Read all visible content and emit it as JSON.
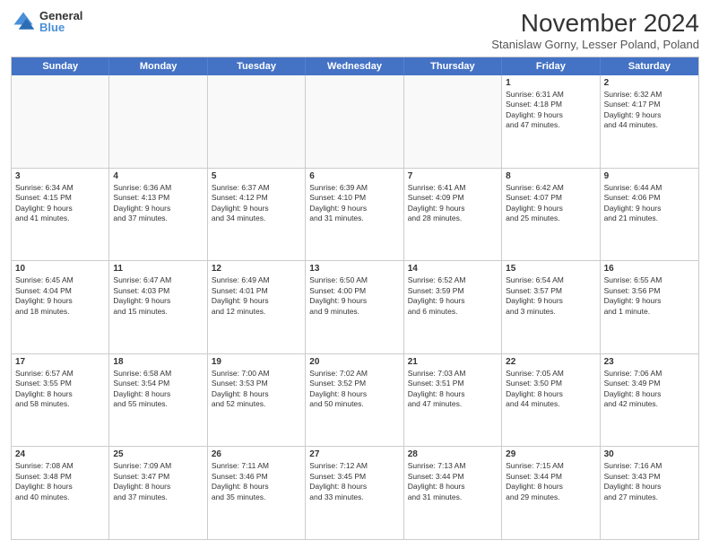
{
  "logo": {
    "general": "General",
    "blue": "Blue"
  },
  "title": "November 2024",
  "subtitle": "Stanislaw Gorny, Lesser Poland, Poland",
  "dayHeaders": [
    "Sunday",
    "Monday",
    "Tuesday",
    "Wednesday",
    "Thursday",
    "Friday",
    "Saturday"
  ],
  "weeks": [
    [
      {
        "day": "",
        "info": "",
        "empty": true
      },
      {
        "day": "",
        "info": "",
        "empty": true
      },
      {
        "day": "",
        "info": "",
        "empty": true
      },
      {
        "day": "",
        "info": "",
        "empty": true
      },
      {
        "day": "",
        "info": "",
        "empty": true
      },
      {
        "day": "1",
        "info": "Sunrise: 6:31 AM\nSunset: 4:18 PM\nDaylight: 9 hours\nand 47 minutes."
      },
      {
        "day": "2",
        "info": "Sunrise: 6:32 AM\nSunset: 4:17 PM\nDaylight: 9 hours\nand 44 minutes."
      }
    ],
    [
      {
        "day": "3",
        "info": "Sunrise: 6:34 AM\nSunset: 4:15 PM\nDaylight: 9 hours\nand 41 minutes."
      },
      {
        "day": "4",
        "info": "Sunrise: 6:36 AM\nSunset: 4:13 PM\nDaylight: 9 hours\nand 37 minutes."
      },
      {
        "day": "5",
        "info": "Sunrise: 6:37 AM\nSunset: 4:12 PM\nDaylight: 9 hours\nand 34 minutes."
      },
      {
        "day": "6",
        "info": "Sunrise: 6:39 AM\nSunset: 4:10 PM\nDaylight: 9 hours\nand 31 minutes."
      },
      {
        "day": "7",
        "info": "Sunrise: 6:41 AM\nSunset: 4:09 PM\nDaylight: 9 hours\nand 28 minutes."
      },
      {
        "day": "8",
        "info": "Sunrise: 6:42 AM\nSunset: 4:07 PM\nDaylight: 9 hours\nand 25 minutes."
      },
      {
        "day": "9",
        "info": "Sunrise: 6:44 AM\nSunset: 4:06 PM\nDaylight: 9 hours\nand 21 minutes."
      }
    ],
    [
      {
        "day": "10",
        "info": "Sunrise: 6:45 AM\nSunset: 4:04 PM\nDaylight: 9 hours\nand 18 minutes."
      },
      {
        "day": "11",
        "info": "Sunrise: 6:47 AM\nSunset: 4:03 PM\nDaylight: 9 hours\nand 15 minutes."
      },
      {
        "day": "12",
        "info": "Sunrise: 6:49 AM\nSunset: 4:01 PM\nDaylight: 9 hours\nand 12 minutes."
      },
      {
        "day": "13",
        "info": "Sunrise: 6:50 AM\nSunset: 4:00 PM\nDaylight: 9 hours\nand 9 minutes."
      },
      {
        "day": "14",
        "info": "Sunrise: 6:52 AM\nSunset: 3:59 PM\nDaylight: 9 hours\nand 6 minutes."
      },
      {
        "day": "15",
        "info": "Sunrise: 6:54 AM\nSunset: 3:57 PM\nDaylight: 9 hours\nand 3 minutes."
      },
      {
        "day": "16",
        "info": "Sunrise: 6:55 AM\nSunset: 3:56 PM\nDaylight: 9 hours\nand 1 minute."
      }
    ],
    [
      {
        "day": "17",
        "info": "Sunrise: 6:57 AM\nSunset: 3:55 PM\nDaylight: 8 hours\nand 58 minutes."
      },
      {
        "day": "18",
        "info": "Sunrise: 6:58 AM\nSunset: 3:54 PM\nDaylight: 8 hours\nand 55 minutes."
      },
      {
        "day": "19",
        "info": "Sunrise: 7:00 AM\nSunset: 3:53 PM\nDaylight: 8 hours\nand 52 minutes."
      },
      {
        "day": "20",
        "info": "Sunrise: 7:02 AM\nSunset: 3:52 PM\nDaylight: 8 hours\nand 50 minutes."
      },
      {
        "day": "21",
        "info": "Sunrise: 7:03 AM\nSunset: 3:51 PM\nDaylight: 8 hours\nand 47 minutes."
      },
      {
        "day": "22",
        "info": "Sunrise: 7:05 AM\nSunset: 3:50 PM\nDaylight: 8 hours\nand 44 minutes."
      },
      {
        "day": "23",
        "info": "Sunrise: 7:06 AM\nSunset: 3:49 PM\nDaylight: 8 hours\nand 42 minutes."
      }
    ],
    [
      {
        "day": "24",
        "info": "Sunrise: 7:08 AM\nSunset: 3:48 PM\nDaylight: 8 hours\nand 40 minutes."
      },
      {
        "day": "25",
        "info": "Sunrise: 7:09 AM\nSunset: 3:47 PM\nDaylight: 8 hours\nand 37 minutes."
      },
      {
        "day": "26",
        "info": "Sunrise: 7:11 AM\nSunset: 3:46 PM\nDaylight: 8 hours\nand 35 minutes."
      },
      {
        "day": "27",
        "info": "Sunrise: 7:12 AM\nSunset: 3:45 PM\nDaylight: 8 hours\nand 33 minutes."
      },
      {
        "day": "28",
        "info": "Sunrise: 7:13 AM\nSunset: 3:44 PM\nDaylight: 8 hours\nand 31 minutes."
      },
      {
        "day": "29",
        "info": "Sunrise: 7:15 AM\nSunset: 3:44 PM\nDaylight: 8 hours\nand 29 minutes."
      },
      {
        "day": "30",
        "info": "Sunrise: 7:16 AM\nSunset: 3:43 PM\nDaylight: 8 hours\nand 27 minutes."
      }
    ]
  ]
}
